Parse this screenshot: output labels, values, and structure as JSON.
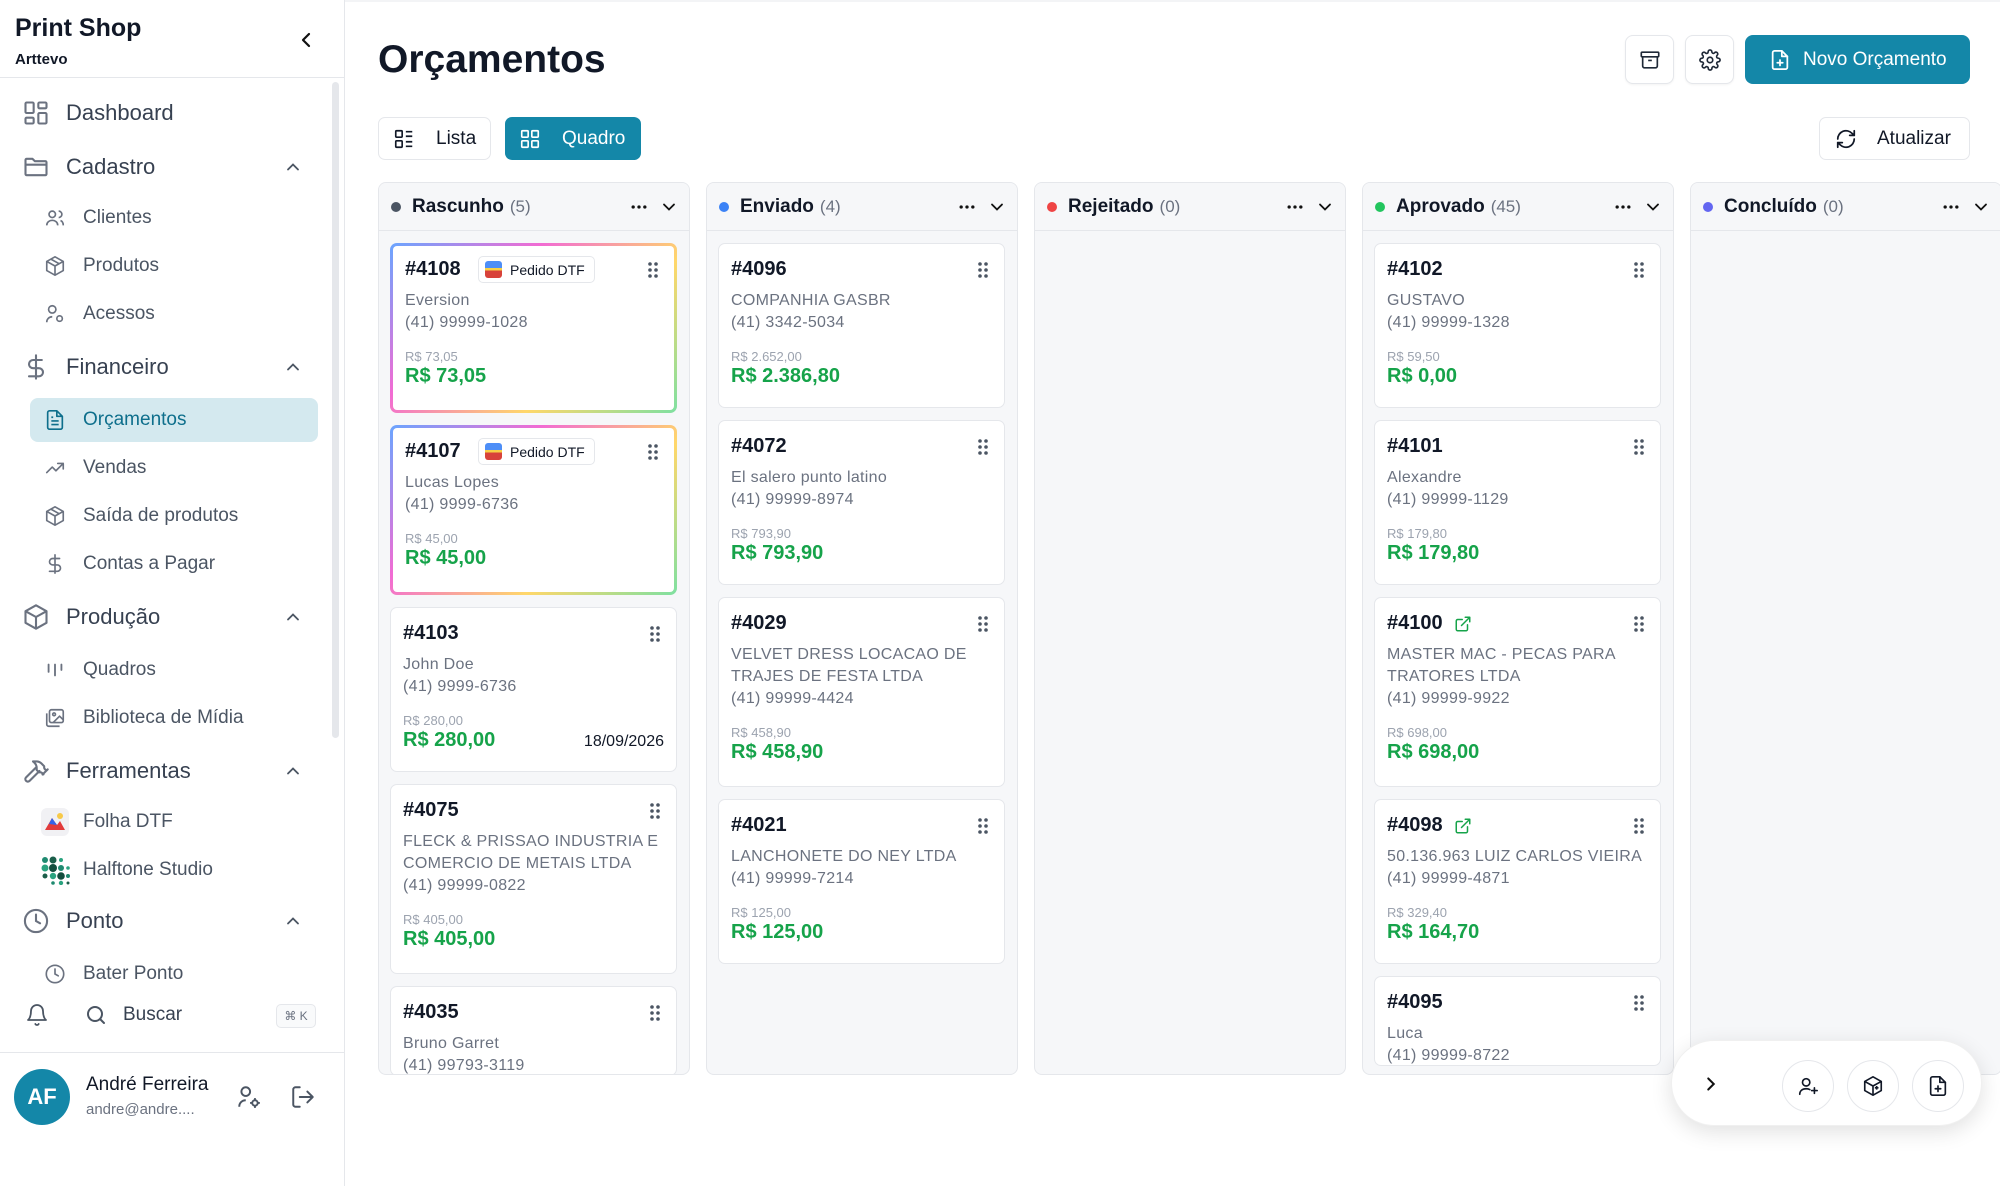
{
  "brand": {
    "name": "Print Shop",
    "sub": "Arttevo"
  },
  "sidebar": {
    "dashboard": "Dashboard",
    "cadastro": {
      "label": "Cadastro",
      "items": [
        "Clientes",
        "Produtos",
        "Acessos"
      ]
    },
    "financeiro": {
      "label": "Financeiro",
      "items": [
        "Orçamentos",
        "Vendas",
        "Saída de produtos",
        "Contas a Pagar"
      ]
    },
    "producao": {
      "label": "Produção",
      "items": [
        "Quadros",
        "Biblioteca de Mídia"
      ]
    },
    "ferramentas": {
      "label": "Ferramentas",
      "items": [
        "Folha DTF",
        "Halftone Studio"
      ]
    },
    "ponto": {
      "label": "Ponto",
      "items": [
        "Bater Ponto"
      ]
    },
    "search": {
      "label": "Buscar",
      "shortcut": "⌘ K"
    },
    "active": "Orçamentos"
  },
  "user": {
    "initials": "AF",
    "name": "André Ferreira",
    "email": "andre@andre...."
  },
  "page": {
    "title": "Orçamentos",
    "new_button": "Novo Orçamento",
    "view_list": "Lista",
    "view_board": "Quadro",
    "refresh": "Atualizar",
    "active_view": "Quadro"
  },
  "colors": {
    "accent": "#1487a8",
    "green": "#16a34a",
    "rascunho": "#4b5563",
    "enviado": "#3b82f6",
    "rejeitado": "#ef4444",
    "aprovado": "#22c55e",
    "concluido": "#6366f1"
  },
  "columns": [
    {
      "title": "Rascunho",
      "count": "(5)",
      "color": "#4b5563",
      "cards": [
        {
          "id": "#4108",
          "badge": "Pedido DTF",
          "client": "Eversion",
          "phone": "(41) 99999-1028",
          "original": "R$ 73,05",
          "total": "R$ 73,05"
        },
        {
          "id": "#4107",
          "badge": "Pedido DTF",
          "client": "Lucas Lopes",
          "phone": "(41) 9999-6736",
          "original": "R$ 45,00",
          "total": "R$ 45,00"
        },
        {
          "id": "#4103",
          "client": "John Doe",
          "phone": "(41) 9999-6736",
          "original": "R$ 280,00",
          "total": "R$ 280,00",
          "date": "18/09/2026"
        },
        {
          "id": "#4075",
          "client": "FLECK & PRISSAO INDUSTRIA E COMERCIO DE METAIS LTDA",
          "phone": "(41) 99999-0822",
          "original": "R$ 405,00",
          "total": "R$ 405,00"
        },
        {
          "id": "#4035",
          "client": "Bruno Garret",
          "phone": "(41) 99793-3119"
        }
      ]
    },
    {
      "title": "Enviado",
      "count": "(4)",
      "color": "#3b82f6",
      "cards": [
        {
          "id": "#4096",
          "client": "COMPANHIA GASBR",
          "phone": "(41) 3342-5034",
          "original": "R$ 2.652,00",
          "total": "R$ 2.386,80"
        },
        {
          "id": "#4072",
          "client": "El salero punto latino",
          "phone": "(41) 99999-8974",
          "original": "R$ 793,90",
          "total": "R$ 793,90"
        },
        {
          "id": "#4029",
          "client": "VELVET DRESS LOCACAO DE TRAJES DE FESTA LTDA",
          "phone": "(41) 99999-4424",
          "original": "R$ 458,90",
          "total": "R$ 458,90"
        },
        {
          "id": "#4021",
          "client": "LANCHONETE DO NEY LTDA",
          "phone": "(41) 99999-7214",
          "original": "R$ 125,00",
          "total": "R$ 125,00"
        }
      ]
    },
    {
      "title": "Rejeitado",
      "count": "(0)",
      "color": "#ef4444",
      "cards": []
    },
    {
      "title": "Aprovado",
      "count": "(45)",
      "color": "#22c55e",
      "cards": [
        {
          "id": "#4102",
          "client": "GUSTAVO",
          "phone": "(41) 99999-1328",
          "original": "R$ 59,50",
          "total": "R$ 0,00"
        },
        {
          "id": "#4101",
          "client": "Alexandre",
          "phone": "(41) 99999-1129",
          "original": "R$ 179,80",
          "total": "R$ 179,80"
        },
        {
          "id": "#4100",
          "client": "MASTER MAC - PECAS PARA TRATORES LTDA",
          "phone": "(41) 99999-9922",
          "original": "R$ 698,00",
          "total": "R$ 698,00",
          "linked": true
        },
        {
          "id": "#4098",
          "client": "50.136.963 LUIZ CARLOS VIEIRA",
          "phone": "(41) 99999-4871",
          "original": "R$ 329,40",
          "total": "R$ 164,70",
          "linked": true
        },
        {
          "id": "#4095",
          "client": "Luca",
          "phone": "(41) 99999-8722"
        }
      ]
    },
    {
      "title": "Concluído",
      "count": "(0)",
      "color": "#6366f1",
      "cards": []
    }
  ]
}
